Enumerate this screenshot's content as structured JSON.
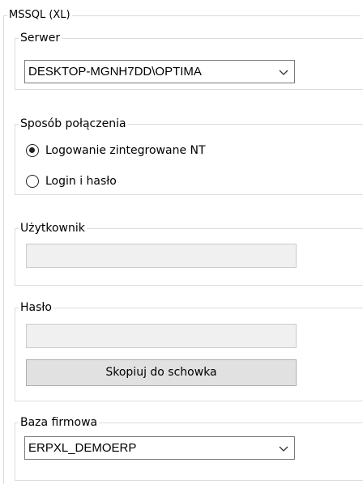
{
  "outer": {
    "title": "MSSQL (XL)"
  },
  "serwer": {
    "legend": "Serwer",
    "value": "DESKTOP-MGNH7DD\\OPTIMA"
  },
  "sposob": {
    "legend": "Sposób połączenia",
    "options": [
      {
        "label": "Logowanie zintegrowane NT",
        "checked": true
      },
      {
        "label": "Login i hasło",
        "checked": false
      }
    ]
  },
  "uzytkownik": {
    "legend": "Użytkownik",
    "value": ""
  },
  "haslo": {
    "legend": "Hasło",
    "value": "",
    "copy_button": "Skopiuj do schowka"
  },
  "baza": {
    "legend": "Baza firmowa",
    "value": "ERPXL_DEMOERP"
  },
  "icons": {
    "dropdown": "chevron-down-icon"
  }
}
